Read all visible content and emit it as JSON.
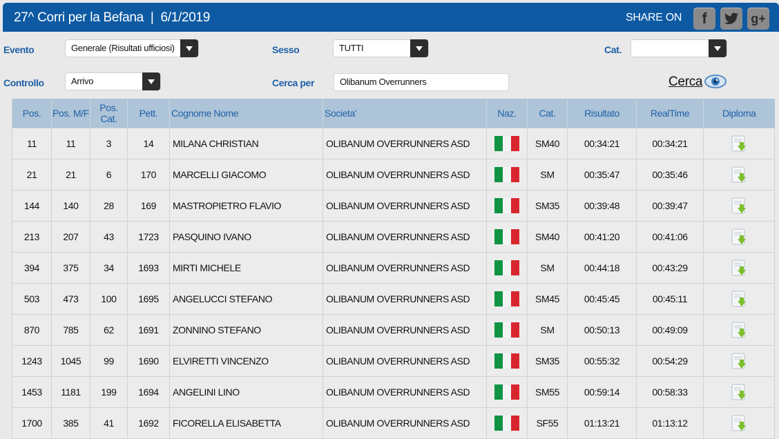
{
  "header": {
    "title": "27^ Corri per la Befana  |  6/1/2019",
    "share_label": "SHARE ON",
    "social": [
      {
        "name": "facebook-icon",
        "glyph": "f"
      },
      {
        "name": "twitter-icon",
        "glyph": ""
      },
      {
        "name": "googleplus-icon",
        "glyph": "g+"
      }
    ]
  },
  "filters": {
    "evento_label": "Evento",
    "evento_value": "Generale (Risultati ufficiosi)",
    "sesso_label": "Sesso",
    "sesso_value": "TUTTI",
    "cat_label": "Cat.",
    "cat_value": "",
    "controllo_label": "Controllo",
    "controllo_value": "Arrivo",
    "cerca_per_label": "Cerca per",
    "cerca_per_value": "Olibanum Overrunners",
    "cerca_label": "Cerca"
  },
  "table": {
    "columns": [
      "Pos.",
      "Pos. M/F",
      "Pos. Cat.",
      "Pett.",
      "Cognome Nome",
      "Societa'",
      "Naz.",
      "Cat.",
      "Risultato",
      "RealTime",
      "Diploma"
    ],
    "rows": [
      {
        "pos": "11",
        "posmf": "11",
        "poscat": "3",
        "pett": "14",
        "nome": "MILANA CHRISTIAN",
        "societa": "OLIBANUM OVERRUNNERS ASD",
        "cat": "SM40",
        "risultato": "00:34:21",
        "realtime": "00:34:21"
      },
      {
        "pos": "21",
        "posmf": "21",
        "poscat": "6",
        "pett": "170",
        "nome": "MARCELLI GIACOMO",
        "societa": "OLIBANUM OVERRUNNERS ASD",
        "cat": "SM",
        "risultato": "00:35:47",
        "realtime": "00:35:46"
      },
      {
        "pos": "144",
        "posmf": "140",
        "poscat": "28",
        "pett": "169",
        "nome": "MASTROPIETRO FLAVIO",
        "societa": "OLIBANUM OVERRUNNERS ASD",
        "cat": "SM35",
        "risultato": "00:39:48",
        "realtime": "00:39:47"
      },
      {
        "pos": "213",
        "posmf": "207",
        "poscat": "43",
        "pett": "1723",
        "nome": "PASQUINO IVANO",
        "societa": "OLIBANUM OVERRUNNERS ASD",
        "cat": "SM40",
        "risultato": "00:41:20",
        "realtime": "00:41:06"
      },
      {
        "pos": "394",
        "posmf": "375",
        "poscat": "34",
        "pett": "1693",
        "nome": "MIRTI MICHELE",
        "societa": "OLIBANUM OVERRUNNERS ASD",
        "cat": "SM",
        "risultato": "00:44:18",
        "realtime": "00:43:29"
      },
      {
        "pos": "503",
        "posmf": "473",
        "poscat": "100",
        "pett": "1695",
        "nome": "ANGELUCCI STEFANO",
        "societa": "OLIBANUM OVERRUNNERS ASD",
        "cat": "SM45",
        "risultato": "00:45:45",
        "realtime": "00:45:11"
      },
      {
        "pos": "870",
        "posmf": "785",
        "poscat": "62",
        "pett": "1691",
        "nome": "ZONNINO STEFANO",
        "societa": "OLIBANUM OVERRUNNERS ASD",
        "cat": "SM",
        "risultato": "00:50:13",
        "realtime": "00:49:09"
      },
      {
        "pos": "1243",
        "posmf": "1045",
        "poscat": "99",
        "pett": "1690",
        "nome": "ELVIRETTI VINCENZO",
        "societa": "OLIBANUM OVERRUNNERS ASD",
        "cat": "SM35",
        "risultato": "00:55:32",
        "realtime": "00:54:29"
      },
      {
        "pos": "1453",
        "posmf": "1181",
        "poscat": "199",
        "pett": "1694",
        "nome": "ANGELINI LINO",
        "societa": "OLIBANUM OVERRUNNERS ASD",
        "cat": "SM55",
        "risultato": "00:59:14",
        "realtime": "00:58:33"
      },
      {
        "pos": "1700",
        "posmf": "385",
        "poscat": "41",
        "pett": "1692",
        "nome": "FICORELLA ELISABETTA",
        "societa": "OLIBANUM OVERRUNNERS ASD",
        "cat": "SF55",
        "risultato": "01:13:21",
        "realtime": "01:13:12"
      }
    ]
  },
  "colors": {
    "header_bg": "#0d5aa3",
    "label_blue": "#1e5fa6",
    "table_head_bg": "#aec4d8"
  }
}
